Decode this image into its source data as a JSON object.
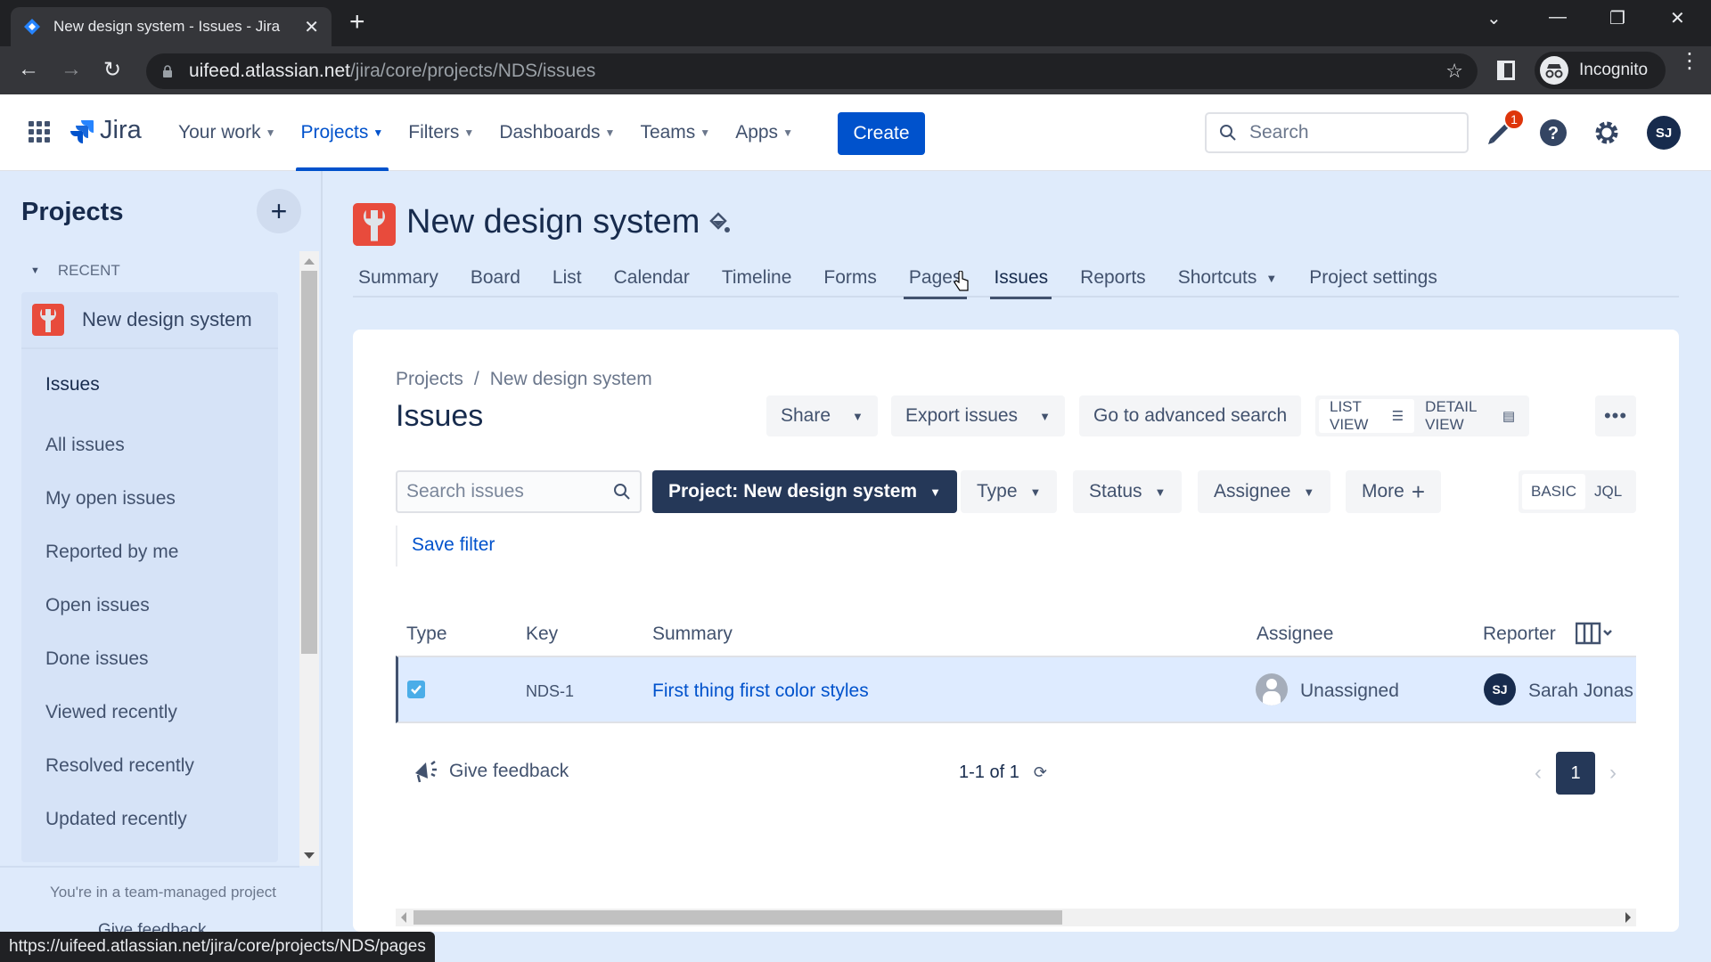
{
  "browser": {
    "tab_title": "New design system - Issues - Jira",
    "url_host": "uifeed.atlassian.net",
    "url_path": "/jira/core/projects/NDS/issues",
    "profile_label": "Incognito",
    "status_url": "https://uifeed.atlassian.net/jira/core/projects/NDS/pages"
  },
  "topnav": {
    "logo_text": "Jira",
    "items": [
      {
        "label": "Your work"
      },
      {
        "label": "Projects"
      },
      {
        "label": "Filters"
      },
      {
        "label": "Dashboards"
      },
      {
        "label": "Teams"
      },
      {
        "label": "Apps"
      }
    ],
    "create_label": "Create",
    "search_placeholder": "Search",
    "notification_count": "1",
    "user_initials": "SJ"
  },
  "sidebar": {
    "title": "Projects",
    "section_label": "RECENT",
    "project_name": "New design system",
    "items": [
      {
        "label": "Issues"
      },
      {
        "label": "All issues"
      },
      {
        "label": "My open issues"
      },
      {
        "label": "Reported by me"
      },
      {
        "label": "Open issues"
      },
      {
        "label": "Done issues"
      },
      {
        "label": "Viewed recently"
      },
      {
        "label": "Resolved recently"
      },
      {
        "label": "Updated recently"
      }
    ],
    "footer_text": "You're in a team-managed project",
    "footer_feedback": "Give feedback"
  },
  "project": {
    "name": "New design system",
    "tabs": [
      {
        "label": "Summary"
      },
      {
        "label": "Board"
      },
      {
        "label": "List"
      },
      {
        "label": "Calendar"
      },
      {
        "label": "Timeline"
      },
      {
        "label": "Forms"
      },
      {
        "label": "Pages"
      },
      {
        "label": "Issues"
      },
      {
        "label": "Reports"
      },
      {
        "label": "Shortcuts"
      },
      {
        "label": "Project settings"
      }
    ]
  },
  "issues": {
    "breadcrumb": [
      "Projects",
      "New design system"
    ],
    "heading": "Issues",
    "actions": {
      "share": "Share",
      "export": "Export issues",
      "advanced": "Go to advanced search",
      "list_view": "LIST VIEW",
      "detail_view": "DETAIL VIEW"
    },
    "search_placeholder": "Search issues",
    "filters": {
      "project_prefix": "Project:",
      "project_value": "New design system",
      "type": "Type",
      "status": "Status",
      "assignee": "Assignee",
      "more": "More"
    },
    "mode": {
      "basic": "BASIC",
      "jql": "JQL"
    },
    "save_filter": "Save filter",
    "columns": [
      "Type",
      "Key",
      "Summary",
      "Assignee",
      "Reporter"
    ],
    "rows": [
      {
        "type": "task",
        "key": "NDS-1",
        "summary": "First thing first color styles",
        "assignee": "Unassigned",
        "reporter": "Sarah Jonas",
        "reporter_initials": "SJ"
      }
    ],
    "feedback": "Give feedback",
    "count": "1-1 of 1",
    "current_page": "1"
  }
}
